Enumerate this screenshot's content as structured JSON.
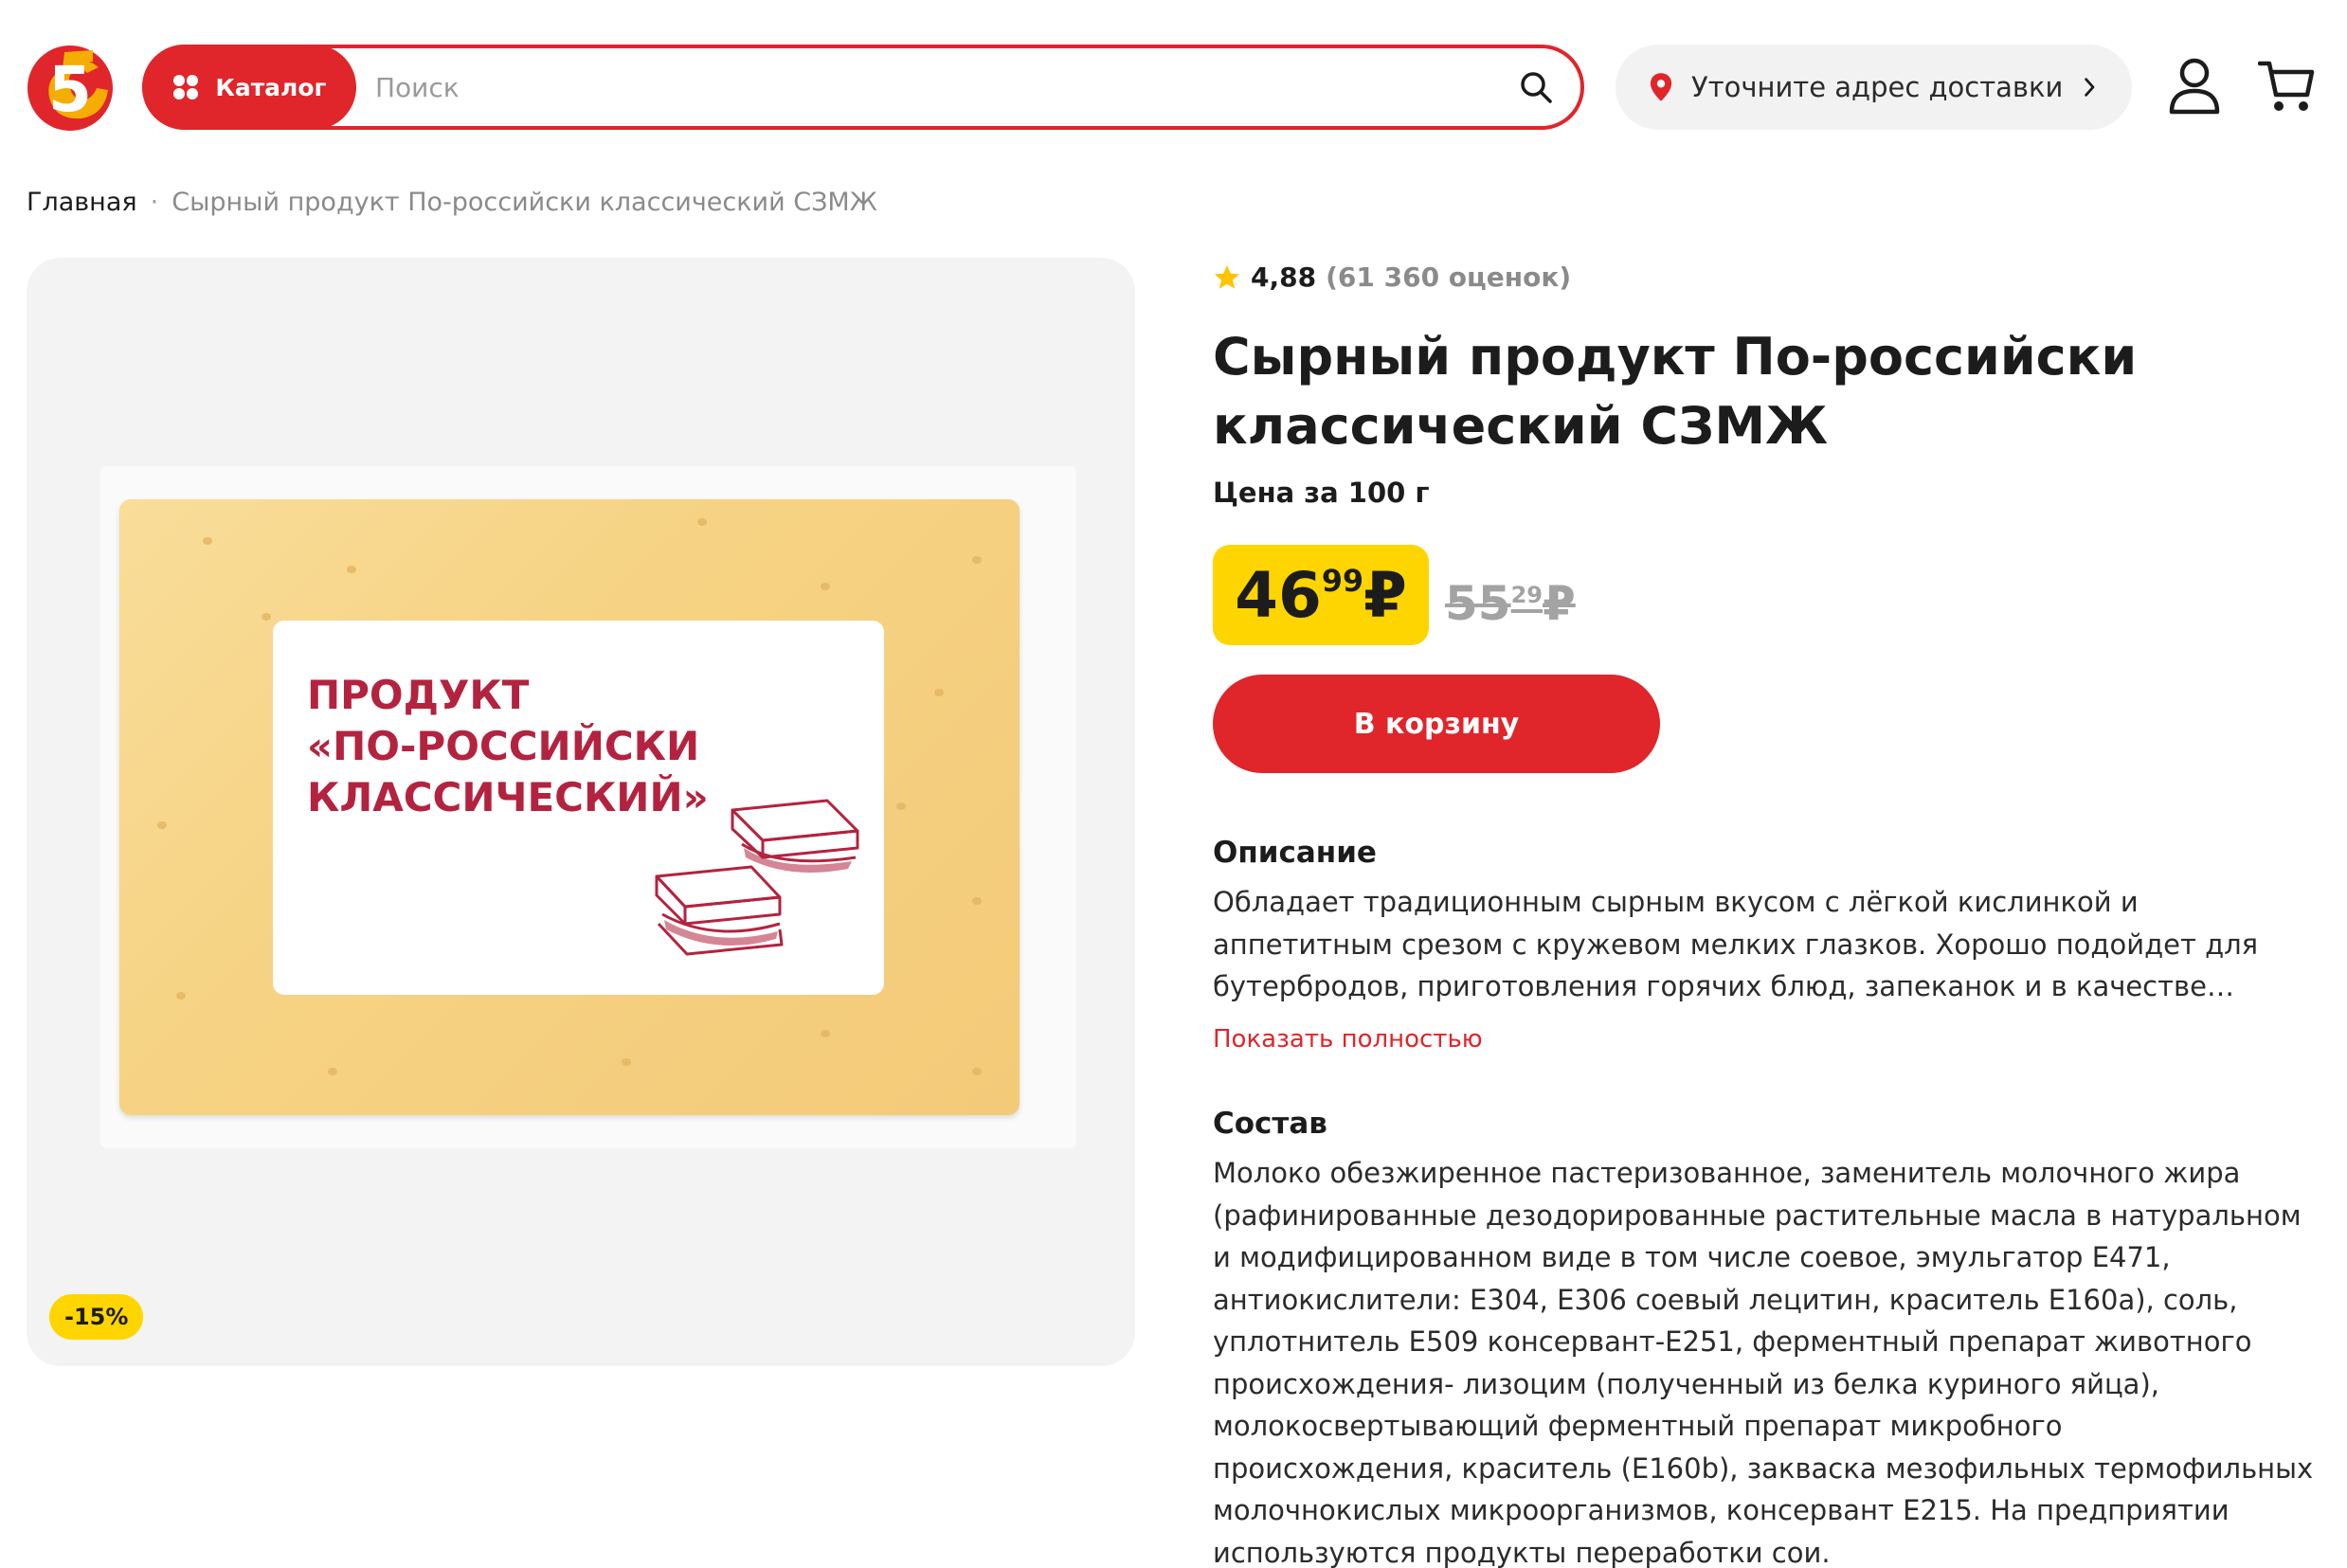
{
  "header": {
    "logo": "5",
    "catalog_label": "Каталог",
    "search_placeholder": "Поиск",
    "address_label": "Уточните адрес доставки"
  },
  "breadcrumb": {
    "home": "Главная",
    "separator": "·",
    "current": "Сырный продукт По-российски классический СЗМЖ"
  },
  "product": {
    "rating_value": "4,88",
    "rating_count": "(61 360 оценок)",
    "title_line1": "Сырный продукт По-российски",
    "title_line2": "классический СЗМЖ",
    "price_unit": "Цена за 100 г",
    "price_rub": "46",
    "price_kop": "99",
    "price_currency": "₽",
    "old_price_rub": "55",
    "old_price_kop": "29",
    "old_price_currency": "₽",
    "discount_badge": "-15%",
    "add_to_cart": "В корзину",
    "package_text": [
      "ПРОДУКТ",
      "«ПО-РОССИЙСКИ",
      "КЛАССИЧЕСКИЙ»"
    ]
  },
  "description": {
    "heading": "Описание",
    "lines": [
      "Обладает традиционным сырным вкусом с лёгкой кислинкой и",
      "аппетитным срезом с кружевом мелких глазков. Хорошо подойдет для",
      "бутербродов, приготовления горячих блюд, запеканок и в качестве…"
    ],
    "show_more": "Показать полностью"
  },
  "composition": {
    "heading": "Состав",
    "lines": [
      "Молоко обезжиренное пастеризованное, заменитель молочного жира",
      "(рафинированные дезодорированные растительные масла в натуральном",
      "и модифицированном виде в том числе соевое, эмульгатор Е471,",
      "антиокислители: Е304, Е306 соевый лецитин, краситель Е160а), соль,",
      "уплотнитель Е509 консервант-Е251, ферментный препарат животного",
      "происхождения- лизоцим (полученный из белка куриного яйца),",
      "молокосвертывающий ферментный препарат микробного",
      "происхождения, краситель (Е160b), закваска мезофильных термофильных",
      "молочнокислых микроорганизмов, консервант Е215. На предприятии",
      "используются продукты переработки сои."
    ]
  },
  "icons": {
    "logo": "pyaterochka-logo",
    "catalog": "grid-dots-icon",
    "search": "search-icon",
    "location": "location-pin-icon",
    "chevron": "chevron-right-icon",
    "user": "user-icon",
    "cart": "cart-icon",
    "star": "star-icon"
  },
  "colors": {
    "brand_red": "#e0252b",
    "price_yellow": "#ffd500",
    "star": "#ffc400"
  }
}
